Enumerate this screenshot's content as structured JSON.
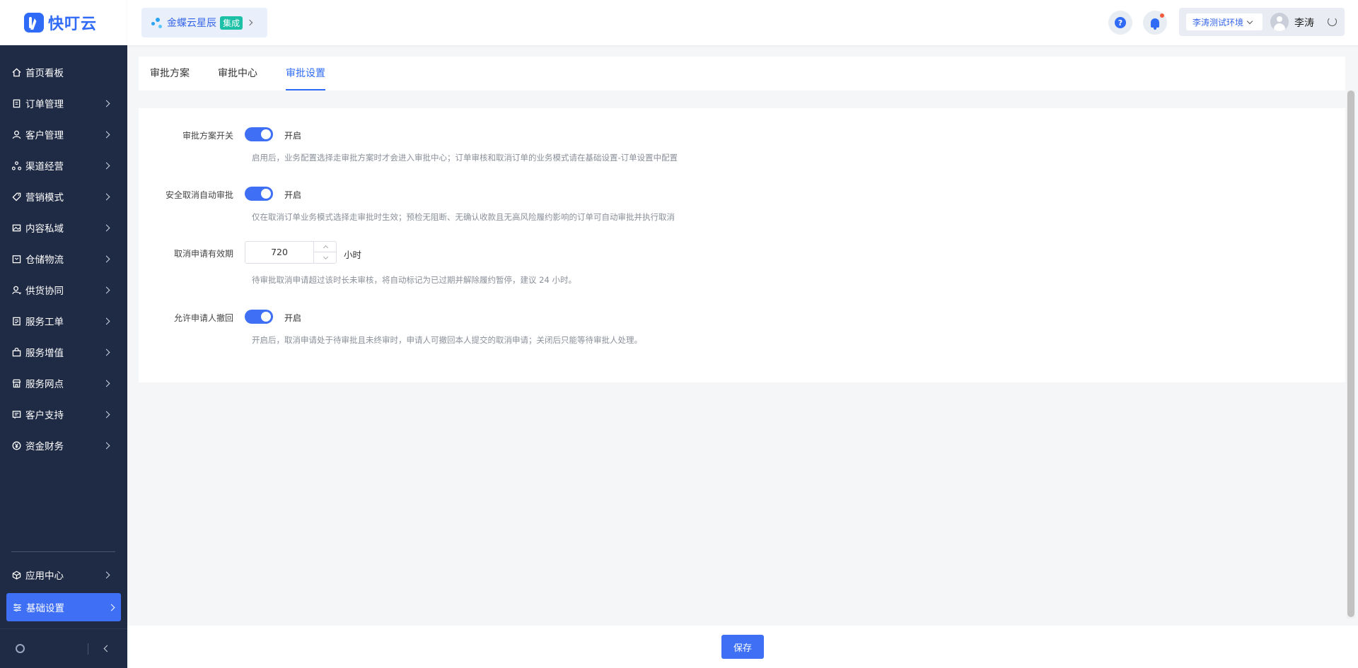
{
  "app": {
    "logo_text": "快叮云"
  },
  "header": {
    "brand_name": "金蝶云星辰",
    "brand_badge": "集成",
    "env_select": "李涛测试环境",
    "user_name": "李涛"
  },
  "sidebar": {
    "items": [
      {
        "label": "首页看板",
        "icon": "home-icon",
        "has_chevron": false
      },
      {
        "label": "订单管理",
        "icon": "clipboard-icon",
        "has_chevron": true
      },
      {
        "label": "客户管理",
        "icon": "user-icon",
        "has_chevron": true
      },
      {
        "label": "渠道经营",
        "icon": "channel-icon",
        "has_chevron": true
      },
      {
        "label": "营销模式",
        "icon": "tag-icon",
        "has_chevron": true
      },
      {
        "label": "内容私域",
        "icon": "image-icon",
        "has_chevron": true
      },
      {
        "label": "仓储物流",
        "icon": "box-icon",
        "has_chevron": true
      },
      {
        "label": "供货协同",
        "icon": "supplier-icon",
        "has_chevron": true
      },
      {
        "label": "服务工单",
        "icon": "ticket-icon",
        "has_chevron": true
      },
      {
        "label": "服务增值",
        "icon": "bag-icon",
        "has_chevron": true
      },
      {
        "label": "服务网点",
        "icon": "store-icon",
        "has_chevron": true
      },
      {
        "label": "客户支持",
        "icon": "support-icon",
        "has_chevron": true
      },
      {
        "label": "资金财务",
        "icon": "yuan-icon",
        "has_chevron": true
      }
    ],
    "bottom_items": [
      {
        "label": "应用中心",
        "icon": "cube-icon",
        "active": false
      },
      {
        "label": "基础设置",
        "icon": "settings-sliders-icon",
        "active": true
      }
    ]
  },
  "tabs": [
    {
      "label": "审批方案",
      "active": false
    },
    {
      "label": "审批中心",
      "active": false
    },
    {
      "label": "审批设置",
      "active": true
    }
  ],
  "form": {
    "approval_switch": {
      "label": "审批方案开关",
      "state_text": "开启",
      "on": true,
      "help": "启用后，业务配置选择走审批方案时才会进入审批中心；订单审核和取消订单的业务模式请在基础设置-订单设置中配置"
    },
    "safe_cancel": {
      "label": "安全取消自动审批",
      "state_text": "开启",
      "on": true,
      "help": "仅在取消订单业务模式选择走审批时生效；预检无阻断、无确认收款且无高风险履约影响的订单可自动审批并执行取消"
    },
    "cancel_valid": {
      "label": "取消申请有效期",
      "value": "720",
      "unit": "小时",
      "help": "待审批取消申请超过该时长未审核，将自动标记为已过期并解除履约暂停，建议 24 小时。"
    },
    "allow_withdraw": {
      "label": "允许申请人撤回",
      "state_text": "开启",
      "on": true,
      "help": "开启后，取消申请处于待审批且未终审时，申请人可撤回本人提交的取消申请；关闭后只能等待审批人处理。"
    }
  },
  "footer": {
    "save_label": "保存"
  },
  "colors": {
    "primary": "#3e6ff5",
    "sidebar_bg": "#1f2a44",
    "badge": "#1cc0a6",
    "notify_dot": "#f25b3d"
  }
}
